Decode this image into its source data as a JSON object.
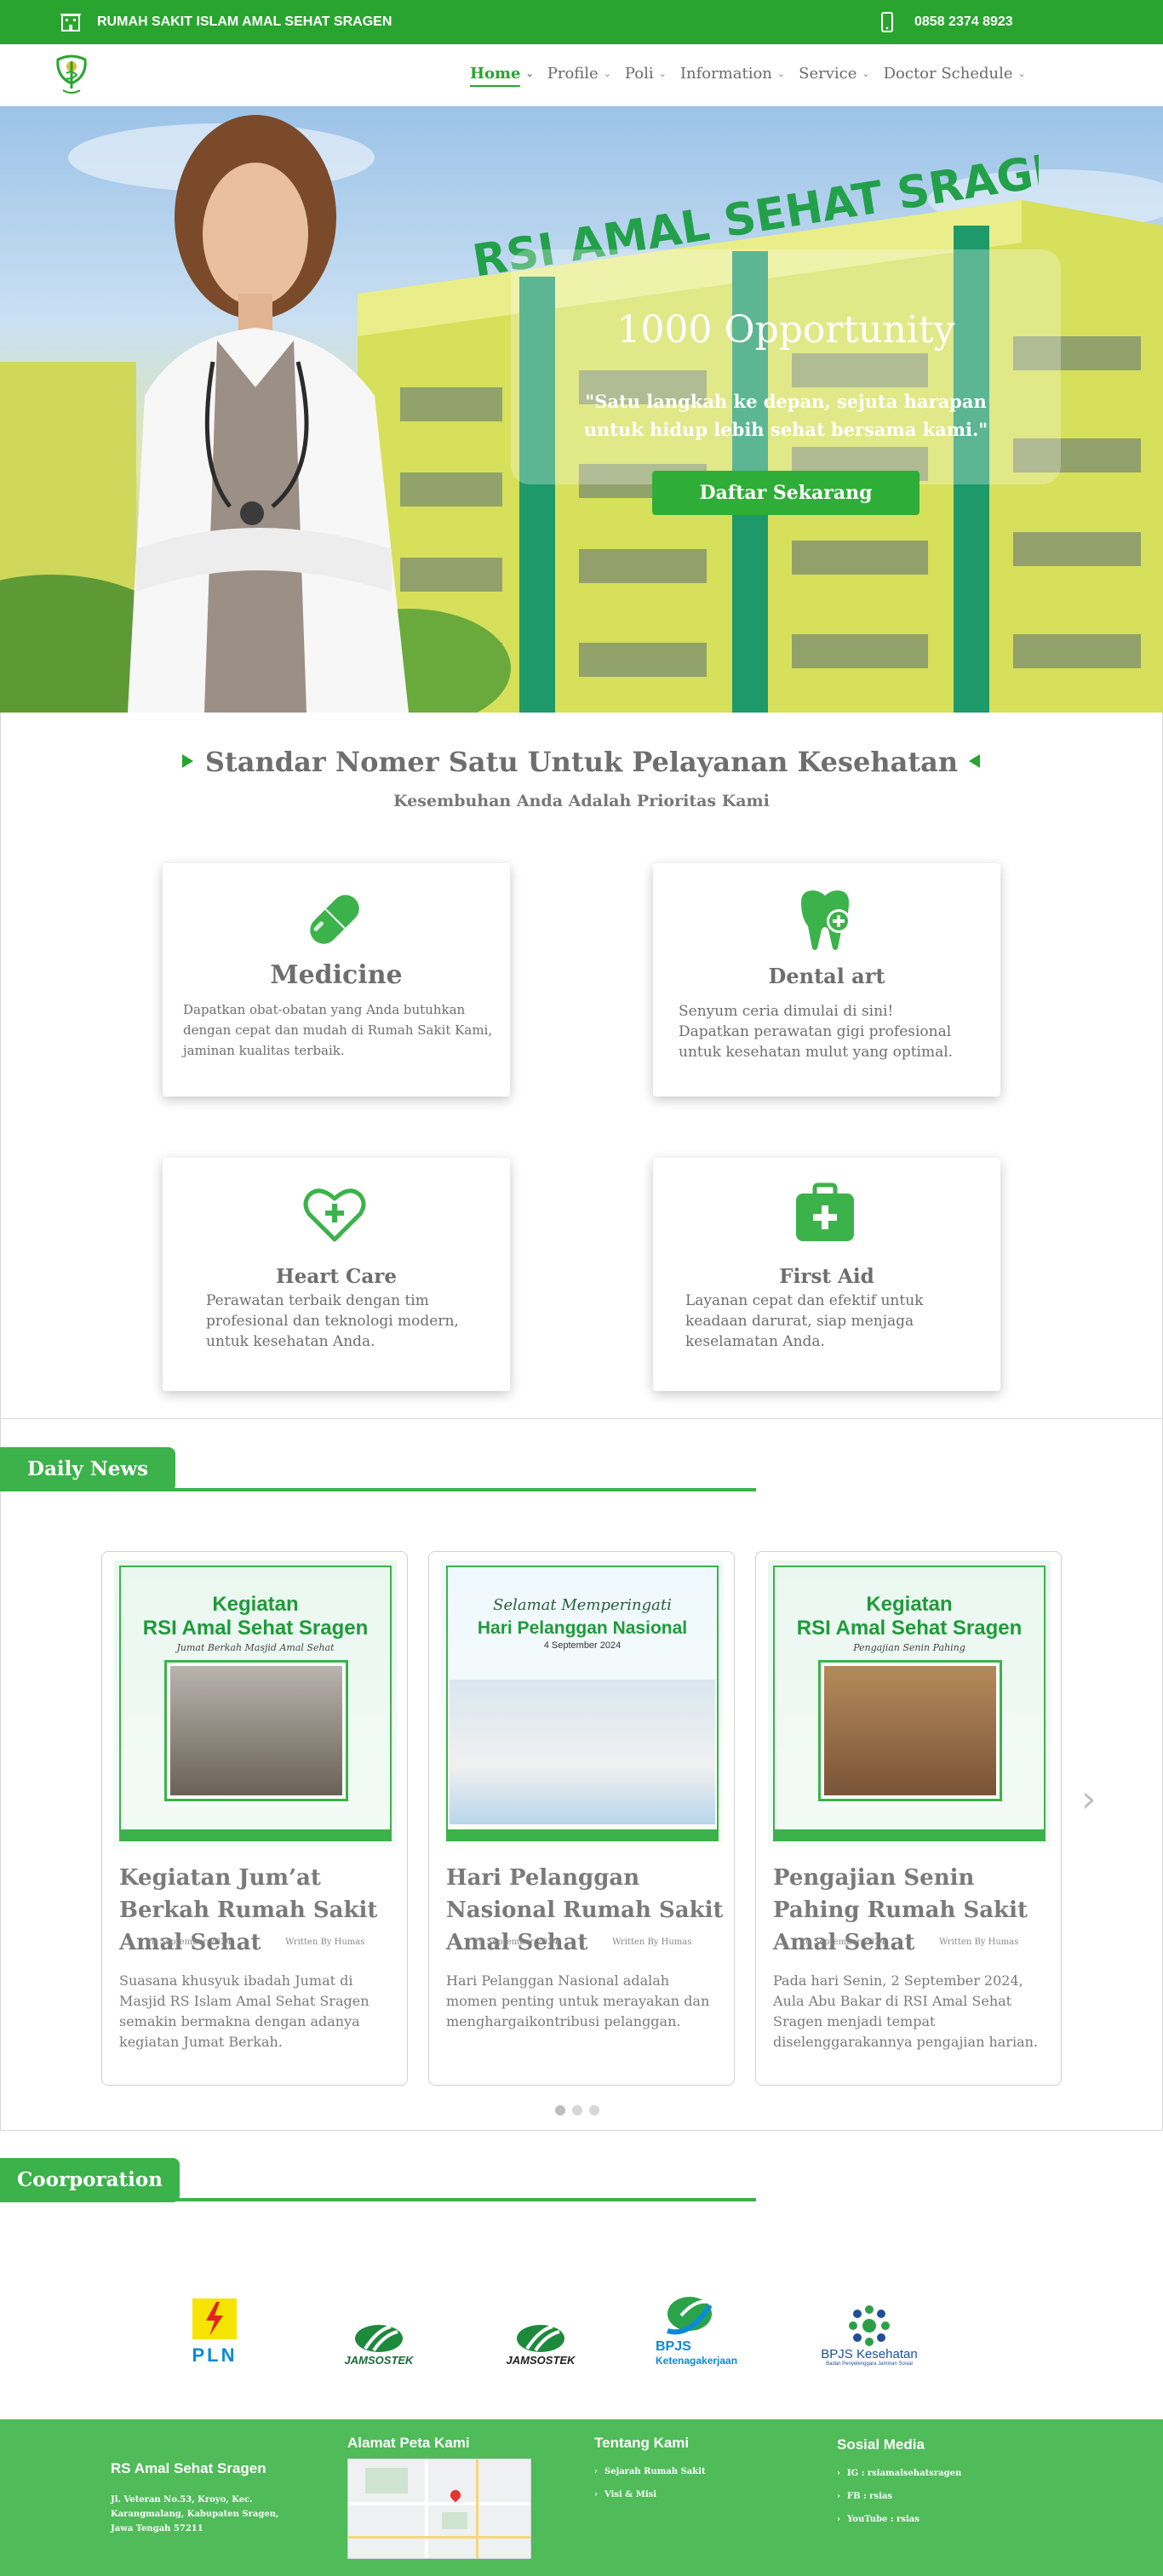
{
  "topbar": {
    "hospital": "RUMAH SAKIT ISLAM AMAL SEHAT SRAGEN",
    "phone": "0858 2374 8923"
  },
  "nav": {
    "items": [
      {
        "label": "Home"
      },
      {
        "label": "Profile"
      },
      {
        "label": "Poli"
      },
      {
        "label": "Information"
      },
      {
        "label": "Service"
      },
      {
        "label": "Doctor Schedule"
      }
    ]
  },
  "hero": {
    "building_sign": "RSI AMAL SEHAT SRAGEN",
    "title": "1000 Opportunity",
    "quote": "\"Satu langkah ke depan, sejuta harapan untuk hidup lebih sehat bersama kami.\"",
    "button": "Daftar Sekarang"
  },
  "services": {
    "heading": "Standar Nomer Satu Untuk Pelayanan Kesehatan",
    "subheading": "Kesembuhan Anda Adalah Prioritas Kami",
    "cards": [
      {
        "title": "Medicine",
        "desc": "Dapatkan obat-obatan yang Anda butuhkan dengan cepat dan mudah di Rumah Sakit Kami,  jaminan kualitas terbaik.",
        "icon": "pill-icon"
      },
      {
        "title": "Dental art",
        "desc": "Senyum ceria dimulai di sini! Dapatkan perawatan gigi profesional untuk kesehatan mulut yang optimal.",
        "icon": "tooth-icon"
      },
      {
        "title": "Heart Care",
        "desc": "Perawatan terbaik dengan tim profesional dan teknologi modern, untuk kesehatan Anda.",
        "icon": "heart-icon"
      },
      {
        "title": "First Aid",
        "desc": "Layanan cepat dan efektif untuk keadaan darurat, siap menjaga keselamatan Anda.",
        "icon": "first-aid-icon"
      }
    ]
  },
  "news": {
    "section_title": "Daily News",
    "items": [
      {
        "title": "Kegiatan Jum’at Berkah Rumah Sakit Amal Sehat",
        "date": "18 September 2024",
        "author": "Written By Humas",
        "desc": "Suasana khusyuk ibadah Jumat di Masjid RS Islam Amal Sehat Sragen semakin bermakna dengan adanya kegiatan Jumat Berkah.",
        "poster_heading": "Kegiatan",
        "poster_title": "RSI Amal Sehat Sragen",
        "poster_sub": "Jumat Berkah Masjid Amal Sehat"
      },
      {
        "title": "Hari Pelanggan Nasional Rumah Sakit Amal Sehat",
        "date": "19 September 2024",
        "author": "Written By Humas",
        "desc": "Hari Pelanggan Nasional adalah momen penting untuk merayakan dan menghargaikontribusi pelanggan.",
        "poster_heading": "Selamat Memperingati",
        "poster_title": "Hari Pelanggan Nasional",
        "poster_sub": "4 September 2024"
      },
      {
        "title": "Pengajian Senin Pahing Rumah Sakit Amal Sehat",
        "date": "20 September 2024",
        "author": "Written By Humas",
        "desc": "Pada hari Senin, 2 September 2024, Aula Abu Bakar di RSI Amal Sehat Sragen menjadi tempat diselenggarakannya pengajian harian.",
        "poster_heading": "Kegiatan",
        "poster_title": "RSI Amal Sehat Sragen",
        "poster_sub": "Pengajian Senin Pahing"
      }
    ]
  },
  "partners": {
    "section_title": "Coorporation",
    "logos": [
      {
        "name": "PLN"
      },
      {
        "name": "JAMSOSTEK"
      },
      {
        "name": "JAMSOSTEK"
      },
      {
        "name": "BPJS",
        "sub": "Ketenagakerjaan"
      },
      {
        "name": "BPJS Kesehatan",
        "sub": "Badan Penyelenggara Jaminan Sosial"
      }
    ]
  },
  "footer": {
    "org": {
      "title": "RS Amal Sehat Sragen",
      "address": "Jl. Veteran No.53, Kroyo, Kec. Karangmalang, Kabupaten Sragen, Jawa Tengah 57211"
    },
    "map": {
      "title": "Alamat Peta Kami"
    },
    "about": {
      "title": "Tentang Kami",
      "links": [
        "Sejarah Rumah Sakit",
        "Visi & Misi"
      ]
    },
    "social": {
      "title": "Sosial Media",
      "links": [
        "IG : rsiamalsehatsragen",
        "FB : rsias",
        "YouTube : rsias"
      ]
    }
  },
  "colors": {
    "brand_green": "#29a52f",
    "footer_green": "#4fbb59"
  }
}
